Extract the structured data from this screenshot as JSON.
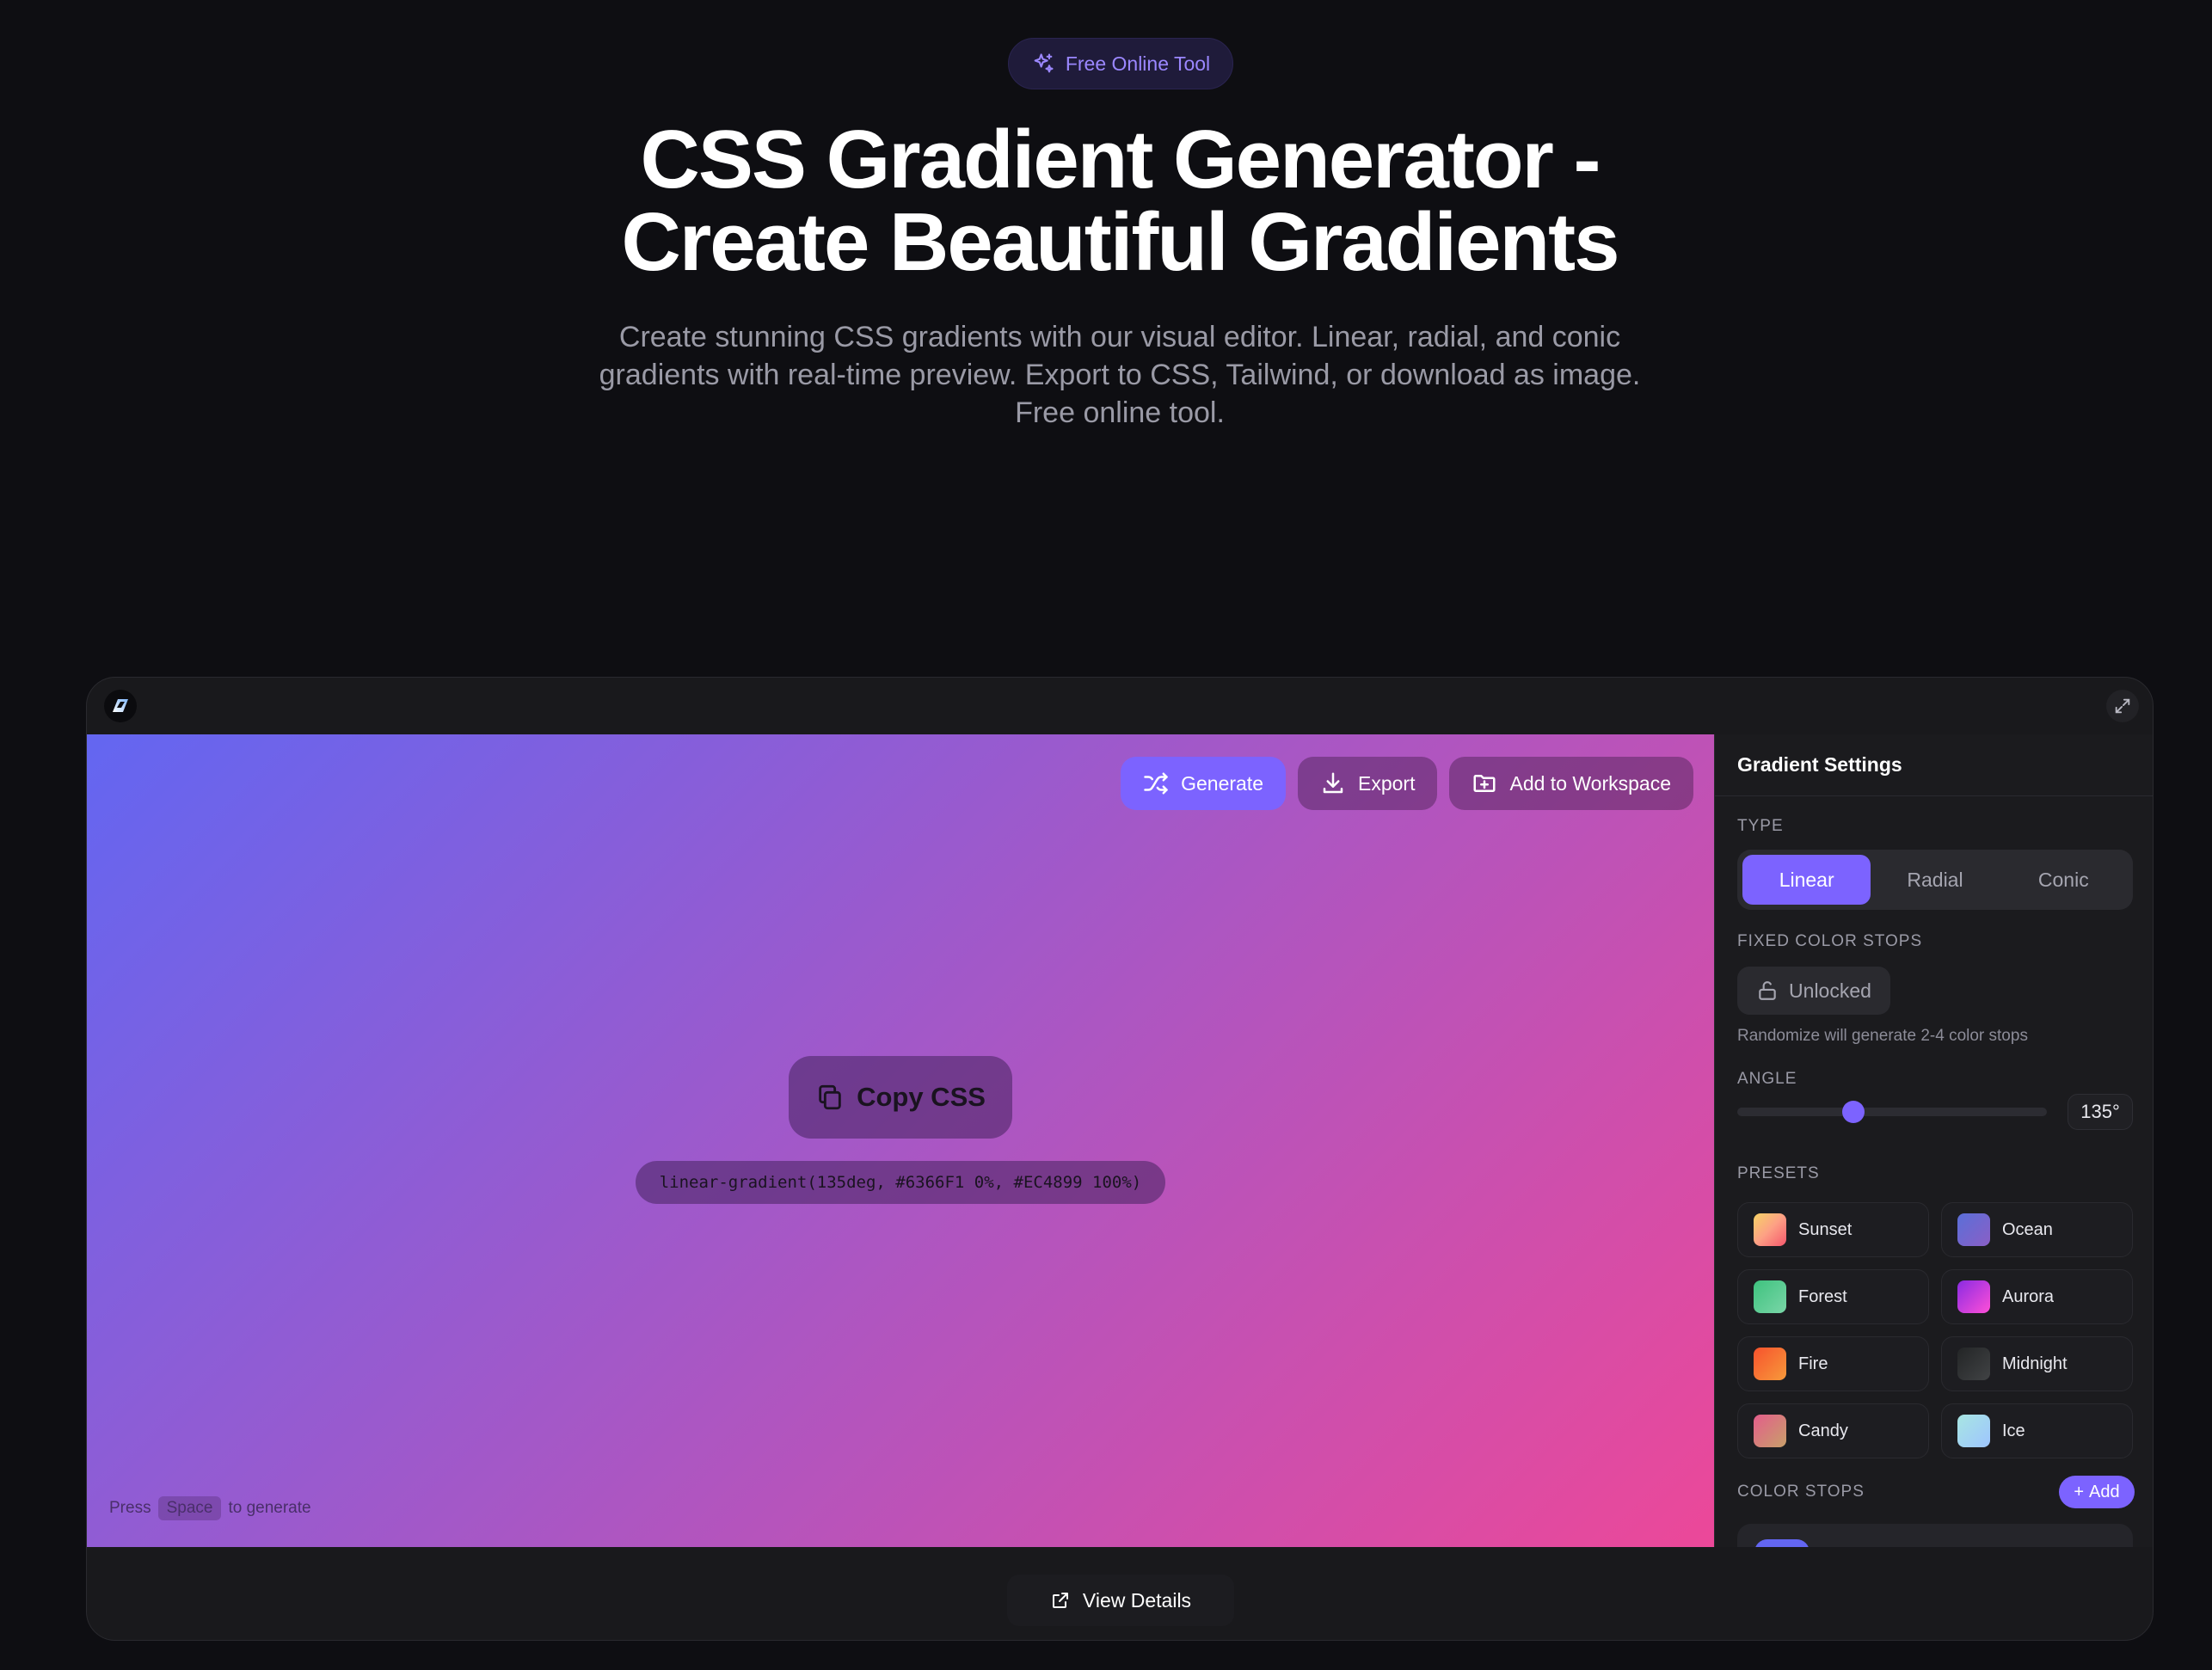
{
  "hero": {
    "badge": "Free Online Tool",
    "title_line1": "CSS Gradient Generator -",
    "title_line2": "Create Beautiful Gradients",
    "subtitle": "Create stunning CSS gradients with our visual editor. Linear, radial, and conic gradients with real-time preview. Export to CSS, Tailwind, or download as image. Free online tool."
  },
  "toolbar": {
    "generate_label": "Generate",
    "export_label": "Export",
    "workspace_label": "Add to Workspace"
  },
  "preview": {
    "copy_label": "Copy CSS",
    "css_code": "linear-gradient(135deg, #6366F1 0%, #EC4899 100%)",
    "hint_before": "Press",
    "hint_key": "Space",
    "hint_after": "to generate",
    "gradient_start": "#6366F1",
    "gradient_end": "#EC4899"
  },
  "settings": {
    "title": "Gradient Settings",
    "type_label": "TYPE",
    "types": [
      "Linear",
      "Radial",
      "Conic"
    ],
    "active_type": "Linear",
    "fixed_label": "FIXED COLOR STOPS",
    "lock_label": "Unlocked",
    "lock_note": "Randomize will generate 2-4 color stops",
    "angle_label": "ANGLE",
    "angle_value": "135°",
    "angle_fraction": 0.375,
    "presets_label": "PRESETS",
    "presets": [
      {
        "name": "Sunset",
        "colors": [
          "#f6d365",
          "#fda085",
          "#f5576c"
        ]
      },
      {
        "name": "Ocean",
        "colors": [
          "#5a6fd8",
          "#8a5fc6"
        ]
      },
      {
        "name": "Forest",
        "colors": [
          "#3ec27e",
          "#7ad6a8"
        ]
      },
      {
        "name": "Aurora",
        "colors": [
          "#8a2be2",
          "#ff4fd8"
        ]
      },
      {
        "name": "Fire",
        "colors": [
          "#f7522d",
          "#f79a3b"
        ]
      },
      {
        "name": "Midnight",
        "colors": [
          "#232526",
          "#414345"
        ]
      },
      {
        "name": "Candy",
        "colors": [
          "#e35d8b",
          "#c8a06a"
        ]
      },
      {
        "name": "Ice",
        "colors": [
          "#a8e6e2",
          "#9ec5ff"
        ]
      }
    ],
    "stops_label": "COLOR STOPS",
    "add_label": "Add"
  },
  "footer": {
    "view_details_label": "View Details"
  },
  "colors": {
    "accent": "#7c63ff",
    "background": "#0e0e12",
    "panel": "#1b1b1e"
  }
}
